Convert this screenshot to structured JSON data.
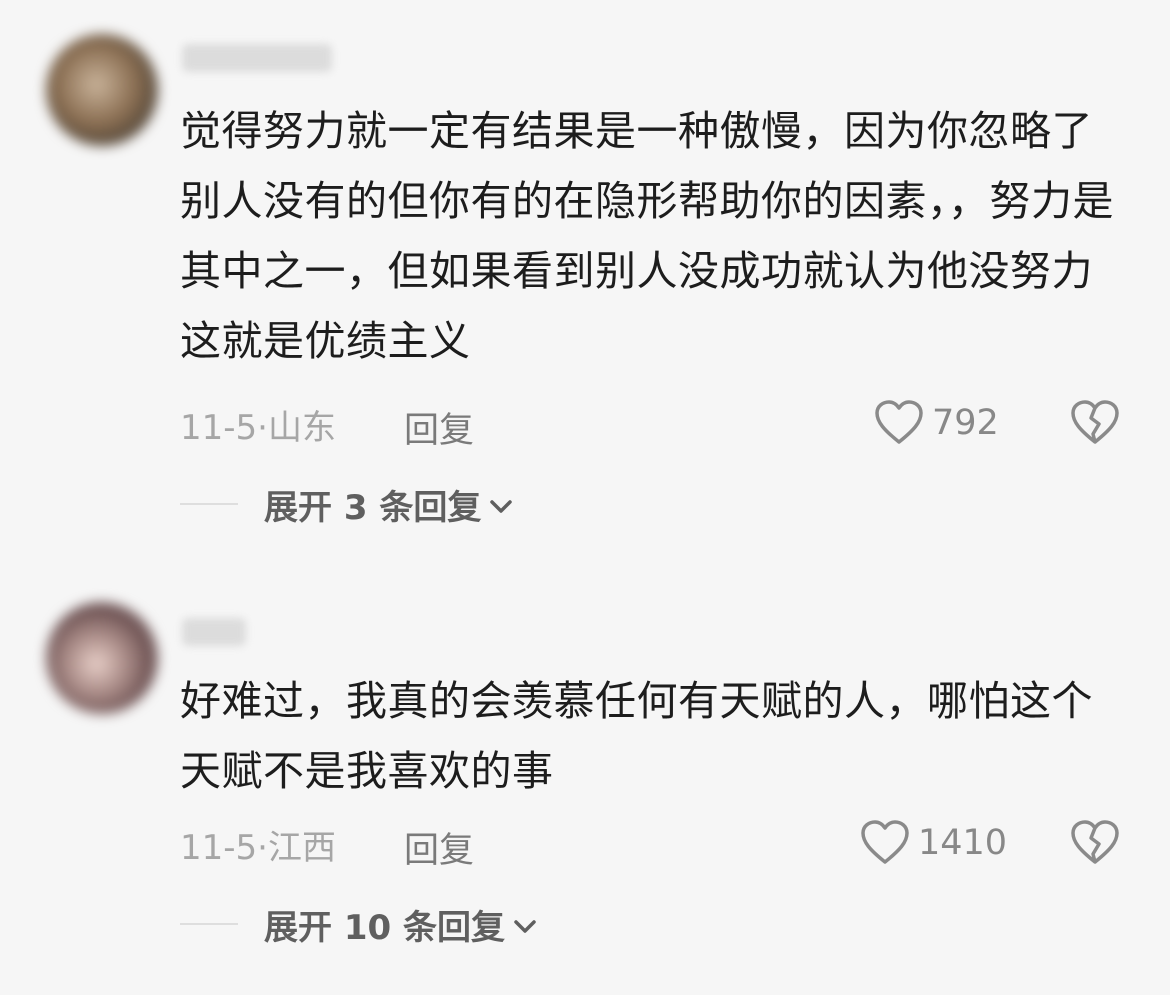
{
  "comments": [
    {
      "text": "觉得努力就一定有结果是一种傲慢，因为你忽略了别人没有的但你有的在隐形帮助你的因素，，努力是其中之一，但如果看到别人没成功就认为他没努力这就是优绩主义",
      "date_location": "11-5·山东",
      "reply_label": "回复",
      "likes": "792",
      "expand_label": "展开 3 条回复",
      "avatar_icon": "avatar-blurred",
      "heart_icon": "heart-outline-icon",
      "dislike_icon": "broken-heart-icon"
    },
    {
      "text": "好难过，我真的会羡慕任何有天赋的人，哪怕这个天赋不是我喜欢的事",
      "date_location": "11-5·江西",
      "reply_label": "回复",
      "likes": "1410",
      "expand_label": "展开 10 条回复",
      "avatar_icon": "avatar-blurred",
      "heart_icon": "heart-outline-icon",
      "dislike_icon": "broken-heart-icon"
    }
  ],
  "colors": {
    "background": "#f6f6f6",
    "text": "#1d1d1d",
    "meta": "#a6a6a6",
    "secondary": "#7a7a7a"
  }
}
